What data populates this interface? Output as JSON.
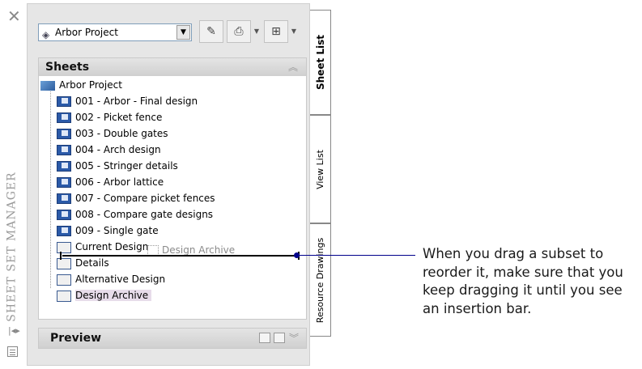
{
  "sidebar": {
    "title": "SHEET SET MANAGER"
  },
  "toolbar": {
    "project_select": "Arbor Project"
  },
  "sheets_panel": {
    "header": "Sheets",
    "root": "Arbor Project",
    "sheets": [
      "001 - Arbor - Final design",
      "002 - Picket fence",
      "003 - Double gates",
      "004 - Arch design",
      "005 - Stringer details",
      "006 - Arbor lattice",
      "007 - Compare picket fences",
      "008 - Compare gate designs",
      "009 - Single gate"
    ],
    "subsets": [
      "Current Design",
      "Details",
      "Alternative Design",
      "Design Archive"
    ],
    "drag_ghost": "Design Archive"
  },
  "preview_panel": {
    "header": "Preview"
  },
  "tabs": {
    "sheet_list": "Sheet List",
    "view_list": "View List",
    "resource_drawings": "Resource Drawings"
  },
  "callout": {
    "text": "When you drag a subset to reorder it, make sure that you keep dragging it until you see an insertion bar."
  },
  "colors": {
    "insertion_bar": "#000000",
    "callout_line": "#00008b",
    "selection": "#e7dcea"
  }
}
